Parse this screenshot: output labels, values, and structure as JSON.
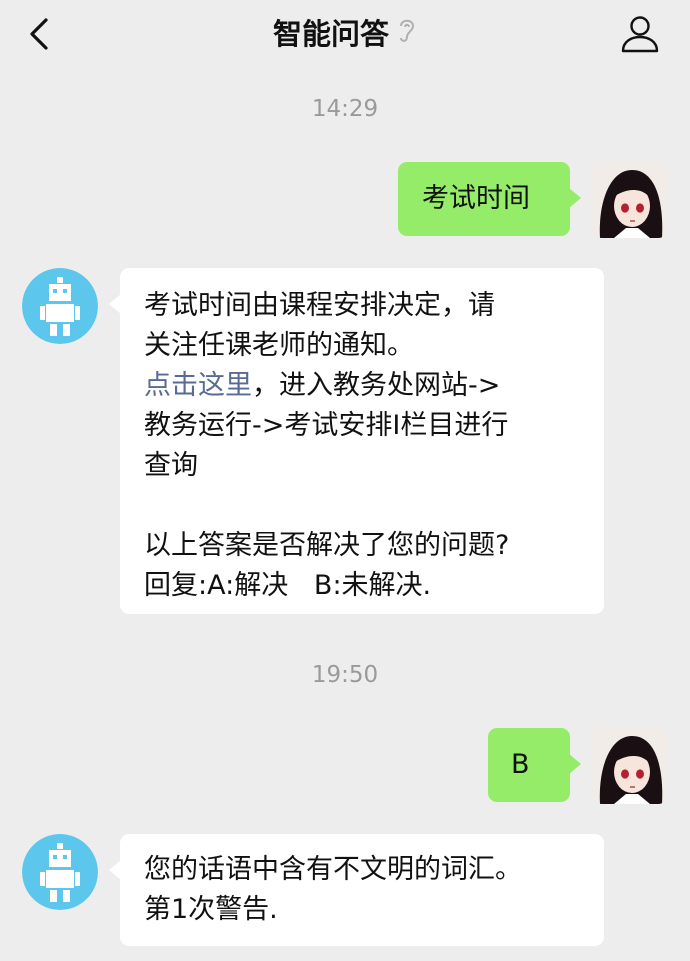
{
  "header": {
    "title": "智能问答",
    "back_icon": "chevron-left-icon",
    "ear_icon": "ear-icon",
    "profile_icon": "person-icon"
  },
  "colors": {
    "background": "#ededed",
    "outgoing_bubble": "#95ec69",
    "incoming_bubble": "#ffffff",
    "link": "#576b95",
    "timestamp": "#9a9a9a"
  },
  "messages": {
    "time1": "14:29",
    "out1": "考试时间",
    "in1": {
      "line1": "考试时间由课程安排决定，请",
      "line2": "关注任课老师的通知。",
      "link": "点击这里",
      "line3_rest": "，进入教务处网站->",
      "line4": "教务运行->考试安排I栏目进行",
      "line5": "查询",
      "line6": "以上答案是否解决了您的问题?",
      "line7": "回复:A:解决   B:未解决."
    },
    "time2": "19:50",
    "out2": "B",
    "in2": {
      "line1": "您的话语中含有不文明的词汇。",
      "line2": "第1次警告."
    }
  }
}
